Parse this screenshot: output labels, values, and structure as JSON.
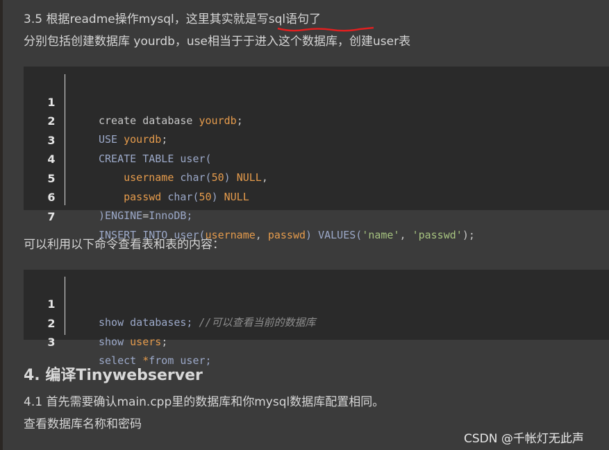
{
  "article": {
    "section_3_5": {
      "title": "3.5 根据readme操作mysql，这里其实就是写sql语句了",
      "desc": "分别包括创建数据库 yourdb，use相当于于进入这个数据库，创建user表"
    },
    "code_block_1": {
      "lines": [
        {
          "n": "1"
        },
        {
          "n": "2"
        },
        {
          "n": "3"
        },
        {
          "n": "4"
        },
        {
          "n": "5"
        },
        {
          "n": "6"
        },
        {
          "n": "7"
        }
      ],
      "tokens": {
        "l1a": "create database ",
        "l1b": "yourdb",
        "l1c": ";",
        "l2a": "USE ",
        "l2b": "yourdb",
        "l2c": ";",
        "l3": "CREATE TABLE user(",
        "l4a": "    ",
        "l4b": "username",
        "l4c": " char(",
        "l4d": "50",
        "l4e": ") ",
        "l4f": "NULL",
        "l4g": ",",
        "l5a": "    ",
        "l5b": "passwd",
        "l5c": " char(",
        "l5d": "50",
        "l5e": ") ",
        "l5f": "NULL",
        "l6a": ")ENGINE",
        "l6b": "=",
        "l6c": "InnoDB;",
        "l7a": "INSERT INTO user(",
        "l7b": "username",
        "l7c": ", ",
        "l7d": "passwd",
        "l7e": ") VALUES(",
        "l7f": "'name'",
        "l7g": ", ",
        "l7h": "'passwd'",
        "l7i": ");"
      }
    },
    "section_view": {
      "text": "可以利用以下命令查看表和表的内容："
    },
    "code_block_2": {
      "lines": [
        {
          "n": "1"
        },
        {
          "n": "2"
        },
        {
          "n": "3"
        }
      ],
      "tokens": {
        "l1a": "show databases; ",
        "l1b": "//可以查看当前的数据库",
        "l2a": "show ",
        "l2b": "users",
        "l2c": ";",
        "l3a": "select ",
        "l3b": "*",
        "l3c": "from user;"
      }
    },
    "section_4": {
      "heading": "4. 编译Tinywebserver",
      "line1": "4.1 首先需要确认main.cpp里的数据库和你mysql数据库配置相同。",
      "line2": "查看数据库名称和密码"
    },
    "watermark": "CSDN @千帐灯无此声"
  },
  "colors": {
    "background": "#3b3b3b",
    "code_background": "#2a2a2a",
    "keyword": "#9ca9c9",
    "identifier": "#e59b4c",
    "string": "#a7c480",
    "comment": "#8e8e8e",
    "annotation_underline": "#e02020"
  }
}
